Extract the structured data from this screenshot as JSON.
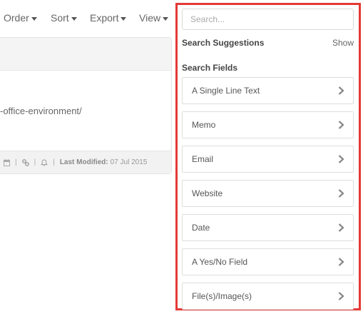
{
  "toolbar": {
    "order_label": "Order",
    "sort_label": "Sort",
    "export_label": "Export",
    "view_label": "View"
  },
  "record": {
    "url_fragment": "-office-environment/",
    "last_modified_label": "Last Modified:",
    "last_modified_value": "07 Jul 2015"
  },
  "panel": {
    "search_placeholder": "Search...",
    "suggestions_label": "Search Suggestions",
    "show_label": "Show",
    "fields_label": "Search Fields",
    "fields": [
      {
        "label": "A Single Line Text"
      },
      {
        "label": "Memo"
      },
      {
        "label": "Email"
      },
      {
        "label": "Website"
      },
      {
        "label": "Date"
      },
      {
        "label": "A Yes/No Field"
      },
      {
        "label": "File(s)/Image(s)"
      }
    ]
  },
  "colors": {
    "highlight_border": "#e53935"
  },
  "icons": [
    "caret-down-icon",
    "calendar-icon",
    "link-icon",
    "bell-icon",
    "chevron-right-icon"
  ]
}
